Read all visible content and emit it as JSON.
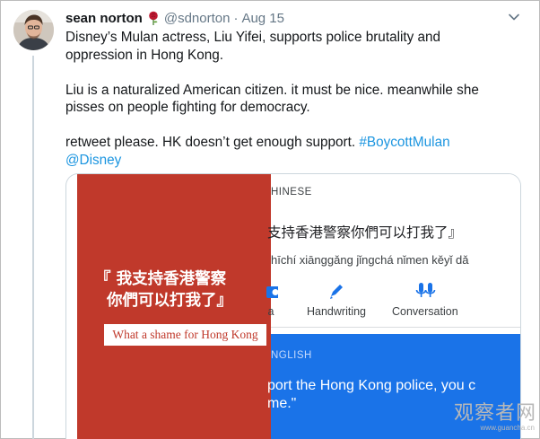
{
  "tweet": {
    "display_name": "sean norton",
    "handle": "@sdnorton",
    "separator": "·",
    "date": "Aug 15",
    "text": {
      "line1": "Disney’s Mulan actress, Liu Yifei, supports police brutality and",
      "line2": "oppression in Hong Kong.",
      "line3": "Liu is a naturalized American citizen. it must be nice. meanwhile she",
      "line4": "pisses on people fighting for democracy.",
      "line5_text": "retweet please. HK doesn’t get enough support. ",
      "line5_hashtag": "#BoycottMulan",
      "line6_mention": "@Disney"
    },
    "colors": {
      "link": "#1b95e0",
      "secondary": "#657786"
    },
    "icons": [
      "rose-emoji-icon",
      "caret-down-icon"
    ]
  },
  "media": {
    "left_panel": {
      "slogan_line1": "『 我支持香港警察",
      "slogan_line2": "你們可以打我了』",
      "caption": "What a shame for Hong Kong",
      "background_color": "#c0392b"
    },
    "translate_panel": {
      "source_lang": "HINESE",
      "source_text": "支持香港警察你們可以打我了』",
      "pinyin": "hīchí xiānggǎng jǐngchá nǐmen kěyǐ dǎ",
      "tools": [
        {
          "label": "a",
          "icon": "camera-icon"
        },
        {
          "label": "Handwriting",
          "icon": "pen-icon"
        },
        {
          "label": "Conversation",
          "icon": "microphone-icon"
        }
      ],
      "target_lang": "NGLISH",
      "target_line1": "port the Hong Kong police, you c",
      "target_line2": "me.\"",
      "accent_color": "#1a73e8"
    }
  },
  "watermark": {
    "chinese": "观察者网",
    "url": "www.guancha.cn"
  }
}
